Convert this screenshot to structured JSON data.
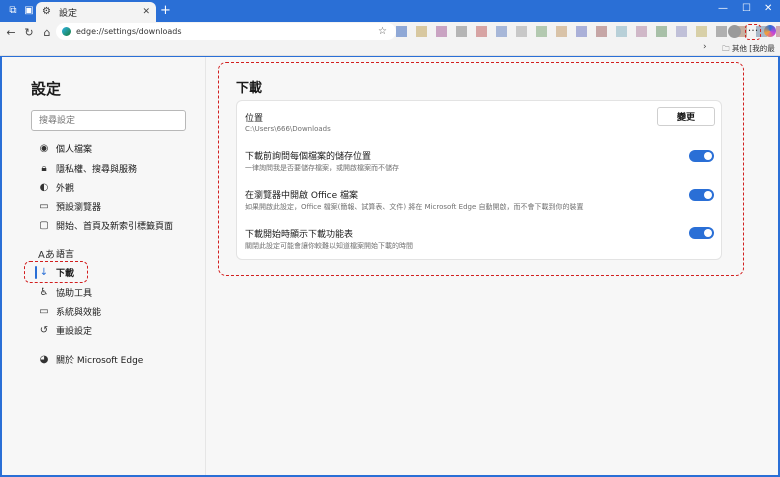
{
  "tab": {
    "title": "設定"
  },
  "address": {
    "url": "edge://settings/downloads"
  },
  "favorites_bar": {
    "other_label": "其他 [我的最愛]"
  },
  "favicons": [
    "#8fa8d6",
    "#d8c8a0",
    "#c9a3c2",
    "#b5b5b5",
    "#d7a4a4",
    "#a7b7d8",
    "#c8c8c8",
    "#b3c9b0",
    "#d9c3a8",
    "#aab0d8",
    "#c6a6a6",
    "#b8d0d8",
    "#d0b8c8",
    "#a8c0a8",
    "#c0c0d8",
    "#d8d0a8",
    "#b0b0b0",
    "#c8b0a0",
    "#a8b8c8",
    "#d0a8b0",
    "#b8c8b8"
  ],
  "sidebar": {
    "title": "設定",
    "search_placeholder": "搜尋設定",
    "items": [
      {
        "label": "個人檔案"
      },
      {
        "label": "隱私權、搜尋與服務"
      },
      {
        "label": "外觀"
      },
      {
        "label": "預設瀏覽器"
      },
      {
        "label": "開始、首頁及新索引標籤頁面"
      },
      {
        "label": "語言"
      },
      {
        "label": "下載"
      },
      {
        "label": "協助工具"
      },
      {
        "label": "系統與效能"
      },
      {
        "label": "重設設定"
      },
      {
        "label": "關於 Microsoft Edge"
      }
    ]
  },
  "downloads": {
    "title": "下載",
    "location": {
      "title": "位置",
      "path": "C:\\Users\\666\\Downloads",
      "button": "變更"
    },
    "ask": {
      "title": "下載前詢問每個檔案的儲存位置",
      "desc": "一律詢問我是否要儲存檔案，或開啟檔案而不儲存"
    },
    "office": {
      "title": "在瀏覽器中開啟 Office 檔案",
      "desc": "如果開啟此設定，Office 檔案(簡報、試算表、文件) 將在 Microsoft Edge 自動開啟，而不會下載到你的裝置"
    },
    "menu": {
      "title": "下載開始時顯示下載功能表",
      "desc": "關閉此設定可能會讓你較難以知道檔案開始下載的時間"
    }
  }
}
